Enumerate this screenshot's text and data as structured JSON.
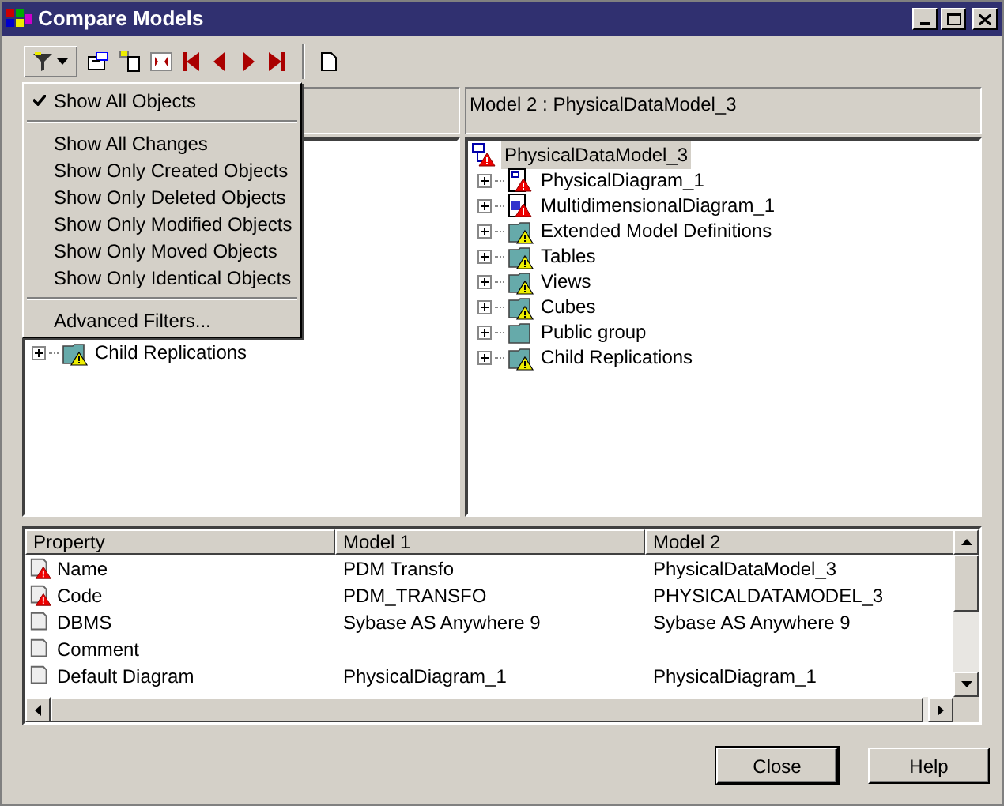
{
  "window": {
    "title": "Compare Models"
  },
  "filter_menu": {
    "groups": [
      {
        "items": [
          {
            "label": "Show All Objects",
            "checked": true
          }
        ]
      },
      {
        "items": [
          {
            "label": "Show All Changes",
            "checked": false
          },
          {
            "label": "Show Only Created Objects",
            "checked": false
          },
          {
            "label": "Show Only Deleted Objects",
            "checked": false
          },
          {
            "label": "Show Only Modified Objects",
            "checked": false
          },
          {
            "label": "Show Only Moved Objects",
            "checked": false
          },
          {
            "label": "Show Only Identical Objects",
            "checked": false
          }
        ]
      },
      {
        "items": [
          {
            "label": "Advanced Filters...",
            "checked": false
          }
        ]
      }
    ]
  },
  "left_pane": {
    "tree": [
      {
        "label": "Child Replications",
        "kind": "folder",
        "warning": true,
        "selected": false
      }
    ]
  },
  "right_pane": {
    "header": "Model 2 : PhysicalDataModel_3",
    "tree": [
      {
        "label": "PhysicalDataModel_3",
        "kind": "model",
        "warning": true,
        "selected": true,
        "children": [
          {
            "label": "PhysicalDiagram_1",
            "kind": "diagram",
            "warning": true,
            "selected": false
          },
          {
            "label": "MultidimensionalDiagram_1",
            "kind": "multidim",
            "warning": true,
            "selected": false
          },
          {
            "label": "Extended Model Definitions",
            "kind": "folder",
            "warning": true,
            "selected": false
          },
          {
            "label": "Tables",
            "kind": "folder",
            "warning": true,
            "selected": false
          },
          {
            "label": "Views",
            "kind": "folder",
            "warning": true,
            "selected": false
          },
          {
            "label": "Cubes",
            "kind": "folder",
            "warning": true,
            "selected": false
          },
          {
            "label": "Public group",
            "kind": "folder",
            "warning": false,
            "selected": false
          },
          {
            "label": "Child Replications",
            "kind": "folder",
            "warning": true,
            "selected": false
          }
        ]
      }
    ]
  },
  "table": {
    "columns": [
      "Property",
      "Model 1",
      "Model 2"
    ],
    "rows": [
      {
        "cells": [
          "Name",
          "PDM Transfo",
          "PhysicalDataModel_3"
        ],
        "warning": true
      },
      {
        "cells": [
          "Code",
          "PDM_TRANSFO",
          "PHYSICALDATAMODEL_3"
        ],
        "warning": true
      },
      {
        "cells": [
          "DBMS",
          "Sybase AS Anywhere 9",
          "Sybase AS Anywhere 9"
        ],
        "warning": false
      },
      {
        "cells": [
          "Comment",
          "",
          ""
        ],
        "warning": false
      },
      {
        "cells": [
          "Default Diagram",
          "PhysicalDiagram_1",
          "PhysicalDiagram_1"
        ],
        "warning": false
      }
    ]
  },
  "buttons": [
    "Close",
    "Help"
  ]
}
